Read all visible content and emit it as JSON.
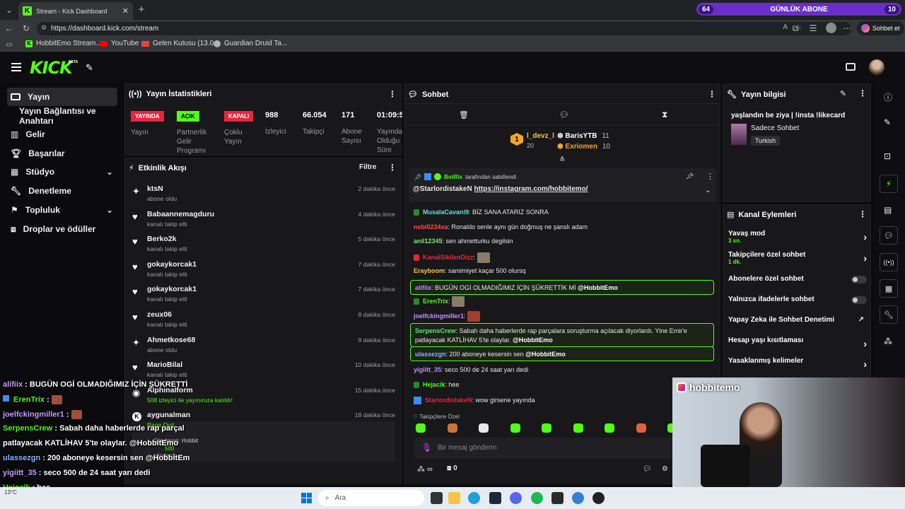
{
  "browser": {
    "tab_title": "Stream - Kick Dashboard",
    "url": "https://dashboard.kick.com/stream",
    "bookmarks": [
      "HobbitEmo Stream...",
      "YouTube",
      "Gelen Kutusu (13.0...",
      "Guardian Druid Ta..."
    ],
    "copilot_label": "Sohbet et",
    "goal_overlay": {
      "left": "64",
      "label": "GÜNLÜK ABONE",
      "right": "10"
    }
  },
  "header": {
    "logo": "KICK",
    "beta": "BETA"
  },
  "sidebar": {
    "items": [
      {
        "label": "Yayın"
      },
      {
        "label": "Yayın Bağlantısı ve Anahtarı"
      },
      {
        "label": "Gelir"
      },
      {
        "label": "Başarılar"
      },
      {
        "label": "Stüdyo"
      },
      {
        "label": "Denetleme"
      },
      {
        "label": "Topluluk"
      },
      {
        "label": "Droplar ve ödüller"
      }
    ]
  },
  "stats": {
    "title": "Yayın İstatistikleri",
    "badges": [
      {
        "badge": "YAYINDA",
        "label": "Yayın",
        "color": "#e5273e"
      },
      {
        "badge": "AÇIK",
        "label": "Partnerlik Gelir Programı",
        "color": "#53fc18"
      },
      {
        "badge": "KAPALI",
        "label": "Çoklu Yayın",
        "color": "#e5273e"
      }
    ],
    "values": [
      {
        "value": "988",
        "label": "İzleyici"
      },
      {
        "value": "66.054",
        "label": "Takipçi"
      },
      {
        "value": "171",
        "label": "Abone Sayısı"
      },
      {
        "value": "01:09:5",
        "label": "Yayında Olduğu Süre"
      }
    ]
  },
  "activity": {
    "title": "Etkinlik Akışı",
    "filter": "Filtre",
    "events": [
      {
        "name": "ktsN",
        "sub": "abone oldu",
        "time": "2 dakika önce",
        "icon": "sparkle"
      },
      {
        "name": "Babaannemagduru",
        "sub": "kanalı takip etti",
        "time": "4 dakika önce",
        "icon": "heart"
      },
      {
        "name": "Berko2k",
        "sub": "kanalı takip etti",
        "time": "5 dakika önce",
        "icon": "heart"
      },
      {
        "name": "gokaykorcak1",
        "sub": "kanalı takip etti",
        "time": "7 dakika önce",
        "icon": "heart"
      },
      {
        "name": "gokaykorcak1",
        "sub": "kanalı takip etti",
        "time": "7 dakika önce",
        "icon": "heart"
      },
      {
        "name": "zeux06",
        "sub": "kanalı takip etti",
        "time": "8 dakika önce",
        "icon": "heart"
      },
      {
        "name": "Ahmetkose68",
        "sub": "abone oldu",
        "time": "9 dakika önce",
        "icon": "sparkle"
      },
      {
        "name": "MarioBilal",
        "sub": "kanalı takip etti",
        "time": "10 dakika önce",
        "icon": "heart"
      },
      {
        "name": "Alphinalform",
        "sub": "508 izleyici ile yayınınıza katıldı!",
        "time": "15 dakika önce",
        "icon": "host"
      },
      {
        "name": "aygunalman",
        "sub": "Rage Quit",
        "time": "18 dakika önce",
        "icon": "kick"
      }
    ],
    "partial": {
      "line1": "Gönderen: Hobbit",
      "amount": "500",
      "line2": "gönderdi"
    }
  },
  "chat": {
    "title": "Sohbet",
    "leaderboard": [
      {
        "rank": "1",
        "name": "l_devz_l",
        "value": "20"
      },
      {
        "name": "BarisYTB",
        "value": "11"
      },
      {
        "name": "Exriomen",
        "value": "10"
      }
    ],
    "pinned": {
      "by": "BotRix",
      "by_suffix": "tarafından sabitlendi",
      "user": "@StarlordistakeN",
      "link": "https://instagram.com/hobbitemo/"
    },
    "messages": [
      {
        "user": "MusalaCavani9",
        "text": ": BİZ SANA ATARIZ SONRA",
        "color": "#5ee3e0"
      },
      {
        "user": "nebi0234xa",
        "text": ": Ronaldo senle aynı gün doğmuş ne şanslı adam",
        "color": "#ff4a4a"
      },
      {
        "user": "anil12345",
        "text": ": sen ahmetturku degilsin",
        "color": "#7ee27e"
      },
      {
        "user": "KanalSikilenDizz",
        "text": ":",
        "color": "#e5273e"
      },
      {
        "user": "Erayboom",
        "text": ": samimiyet kaçar 500 olursq",
        "color": "#f5c542"
      },
      {
        "user": "alifiix",
        "text": ": BUGÜN OGİ OLMADIĞIMIZ İÇİN ŞÜKRETTİK Mİ",
        "mention": "@HobbitEmo",
        "color": "#b58cff"
      },
      {
        "user": "ErenTrix",
        "text": ":",
        "color": "#53fc18"
      },
      {
        "user": "joelfckingmiller1",
        "text": ":",
        "color": "#c78cff"
      },
      {
        "user": "SerpensCrew",
        "text": ": Sabah daha haberlerde rap parçalara soruşturma açılacak diyorlardı. Yine Emir'e patlayacak KATLİHAV 5'te olaylar.",
        "mention": "@HobbitEmo",
        "color": "#5ee37a"
      },
      {
        "user": "ulassezgn",
        "text": ": 200 aboneye kesersin sen",
        "mention": "@HobbitEmo",
        "color": "#8ab4ff"
      },
      {
        "user": "yigiitt_35",
        "text": ": seco 500 de 24 saat yarı dedi",
        "color": "#b58cff"
      },
      {
        "user": "Hejacik",
        "text": ": hee",
        "color": "#53fc18"
      },
      {
        "user": "StarlordistakeN",
        "text": ": wow girsene yayında",
        "color": "#e5273e"
      }
    ],
    "emote_label": "Takipçilere Özel",
    "input_placeholder": "Bir mesaj gönderin",
    "points": "0"
  },
  "stream_info": {
    "title": "Yayın bilgisi",
    "stream_title": "yaşlandın be ziya | !insta !likecard",
    "category": "Sadece Sohbet",
    "language": "Turkish"
  },
  "channel_actions": {
    "title": "Kanal Eylemleri",
    "items": [
      {
        "label": "Yavaş mod",
        "sub": "3 sn.",
        "control": "chevron"
      },
      {
        "label": "Takipçilere özel sohbet",
        "sub": "1 dk.",
        "control": "chevron"
      },
      {
        "label": "Abonelere özel sohbet",
        "control": "toggle"
      },
      {
        "label": "Yalnızca ifadelerle sohbet",
        "control": "toggle"
      },
      {
        "label": "Yapay Zeka ile Sohbet Denetimi",
        "control": "external"
      },
      {
        "label": "Hesap yaşı kısıtlaması",
        "control": "chevron"
      },
      {
        "label": "Yasaklanmış kelimeler",
        "control": "chevron"
      }
    ]
  },
  "webcam": {
    "handle": "hobbitemo"
  },
  "overlay_chat": [
    {
      "user": "alifiix",
      "text": " : BUGÜN OGİ OLMADIĞIMIZ İÇİN ŞÜKRETTİ",
      "color": "#c79cff"
    },
    {
      "user": "ErenTrix",
      "text": " :",
      "color": "#53fc18"
    },
    {
      "user": "joelfckingmiller1",
      "text": " :",
      "color": "#c79cff"
    },
    {
      "user": "SerpensCrew",
      "text": " : Sabah daha haberlerde rap parçal",
      "color": "#53fc18"
    },
    {
      "user": "",
      "text": "patlayacak KATLİHAV 5'te olaylar. @HobbitEmo",
      "color": "#ffffff"
    },
    {
      "user": "ulassezgn",
      "text": " : 200 aboneye kesersin sen @HobbitEm",
      "color": "#8ab4ff"
    },
    {
      "user": "yigiitt_35",
      "text": " : seco 500 de 24 saat yarı dedi",
      "color": "#c79cff"
    },
    {
      "user": "Hejacik",
      "text": " : hee",
      "color": "#53fc18"
    },
    {
      "user": "StarlordistakeN",
      "text": " : wow girsene yayında",
      "color": "#ff4a4a"
    }
  ],
  "taskbar": {
    "weather": "13°C",
    "search": "Ara"
  }
}
